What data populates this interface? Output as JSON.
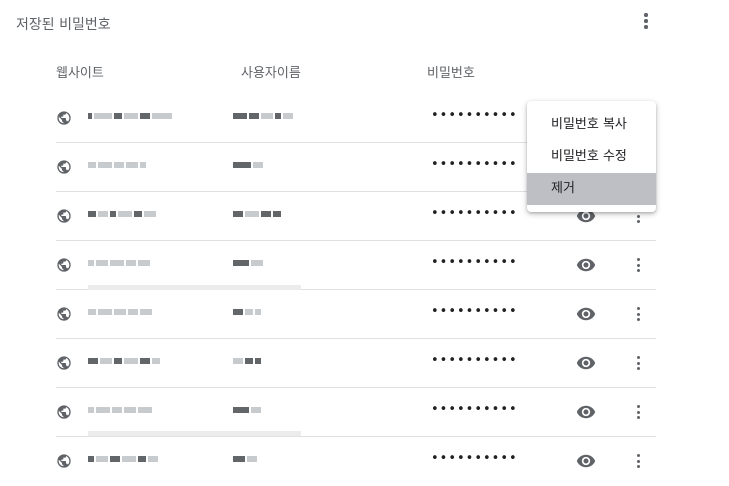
{
  "section": {
    "title": "저장된 비밀번호"
  },
  "columns": {
    "website": "웹사이트",
    "username": "사용자이름",
    "password": "비밀번호"
  },
  "rows": [
    {
      "password": "••••••••••",
      "has_eye": false,
      "has_more": false
    },
    {
      "password": "••••••••••",
      "has_eye": false,
      "has_more": false
    },
    {
      "password": "••••••••••",
      "has_eye": true,
      "has_more": true
    },
    {
      "password": "••••••••••",
      "has_eye": true,
      "has_more": true
    },
    {
      "password": "••••••••••",
      "has_eye": true,
      "has_more": true
    },
    {
      "password": "••••••••••",
      "has_eye": true,
      "has_more": true
    },
    {
      "password": "••••••••••",
      "has_eye": true,
      "has_more": true
    },
    {
      "password": "••••••••••",
      "has_eye": true,
      "has_more": true
    }
  ],
  "context_menu": {
    "items": [
      "비밀번호 복사",
      "비밀번호 수정",
      "제거"
    ],
    "highlighted_index": 2
  },
  "icons": {
    "row_icon": "globe-icon",
    "reveal_icon": "eye-icon",
    "more_icon": "more-vert-icon"
  }
}
